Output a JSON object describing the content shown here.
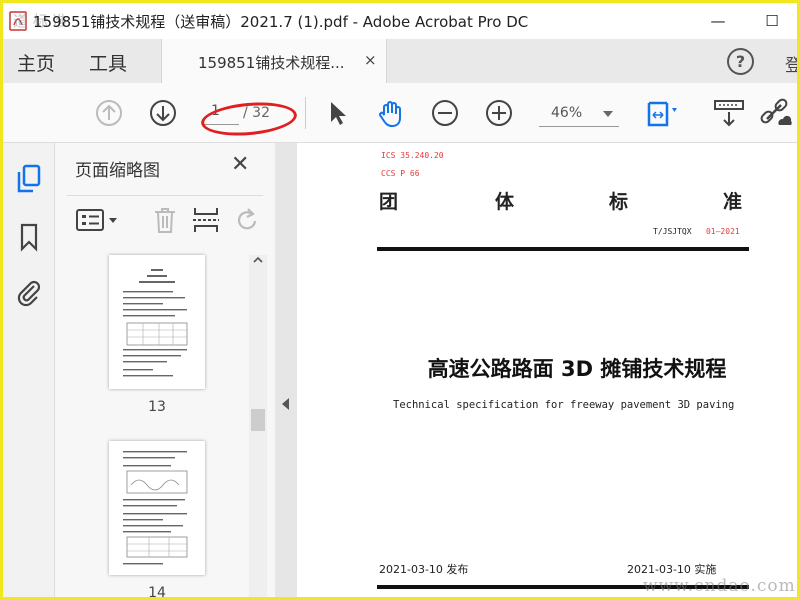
{
  "window": {
    "title": "159851铺技术规程（送审稿）2021.7 (1).pdf - Adobe Acrobat Pro DC",
    "watermark_logo": "道 标 准",
    "minimize": "—",
    "maximize": "☐"
  },
  "menubar": {
    "home": "主页",
    "tools": "工具",
    "tab_label": "159851铺技术规程...",
    "tab_close": "×",
    "help": "?",
    "cut_char": "登"
  },
  "toolbar": {
    "current_page": "1",
    "total_pages": "/ 32",
    "zoom": "46%",
    "annotation_color": "#e02020"
  },
  "panel": {
    "title": "页面缩略图",
    "close": "✕",
    "thumbnails": [
      {
        "number": "13"
      },
      {
        "number": "14"
      }
    ]
  },
  "document": {
    "ics": "ICS  35.240.20",
    "ccs": "CCS  P 66",
    "org_chars": [
      "团",
      "体",
      "标",
      "准"
    ],
    "doc_number_prefix": "T/JSJTQX",
    "doc_number_suffix": "01—2021",
    "title": "高速公路路面 3D 摊铺技术规程",
    "subtitle": "Technical specification for freeway pavement 3D paving",
    "release_date": "2021-03-10 发布",
    "implement_date": "2021-03-10 实施"
  },
  "site_watermark": "www.cndao.com",
  "colors": {
    "accent_blue": "#1473e6",
    "frame_yellow": "#f0e71f",
    "red_text": "#e23b3b"
  }
}
